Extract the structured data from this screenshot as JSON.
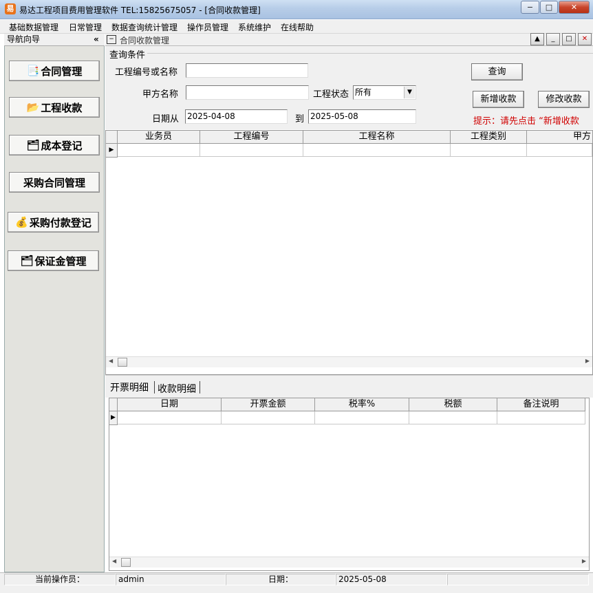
{
  "window": {
    "title": "易达工程项目费用管理软件   TEL:15825675057   - [合同收款管理]",
    "app_icon_glyph": "易",
    "minimize": "−",
    "maximize": "□",
    "close": "✕"
  },
  "menu": [
    "基础数据管理",
    "日常管理",
    "数据查询统计管理",
    "操作员管理",
    "系统维护",
    "在线帮助"
  ],
  "nav": {
    "header": "导航向导",
    "collapse": "«",
    "items": [
      {
        "label": "合同管理",
        "icon": "contract-icon",
        "glyph": "📑"
      },
      {
        "label": "工程收款",
        "icon": "folder-icon",
        "glyph": "📂"
      },
      {
        "label": "成本登记",
        "icon": "cost-icon",
        "glyph": "🗂"
      },
      {
        "label": "采购合同管理",
        "icon": "",
        "glyph": ""
      },
      {
        "label": "采购付款登记",
        "icon": "money-bag-icon",
        "glyph": "💰"
      },
      {
        "label": "保证金管理",
        "icon": "deposit-icon",
        "glyph": "🗂"
      }
    ]
  },
  "child": {
    "title": "合同收款管理",
    "sys_icon": "−"
  },
  "query": {
    "group_label": "查询条件",
    "project_label": "工程编号或名称",
    "project_value": "",
    "party_label": "甲方名称",
    "party_value": "",
    "status_label": "工程状态",
    "status_value": "所有",
    "date_from_label": "日期从",
    "date_from": "2025-04-08",
    "date_to_label": "到",
    "date_to": "2025-05-08",
    "search_button": "查询",
    "add_button": "新增收款",
    "edit_button": "修改收款",
    "hint": "提示：请先点击 “新增收款"
  },
  "main_grid": {
    "columns": [
      "业务员",
      "工程编号",
      "工程名称",
      "工程类别",
      "甲方"
    ]
  },
  "detail_tabs": [
    "开票明细",
    "收款明细"
  ],
  "detail_grid": {
    "columns": [
      "日期",
      "开票金额",
      "税率%",
      "税额",
      "备注说明"
    ]
  },
  "status": {
    "operator_label": "当前操作员：",
    "operator": "admin",
    "date_label": "日期：",
    "date": "2025-05-08"
  }
}
